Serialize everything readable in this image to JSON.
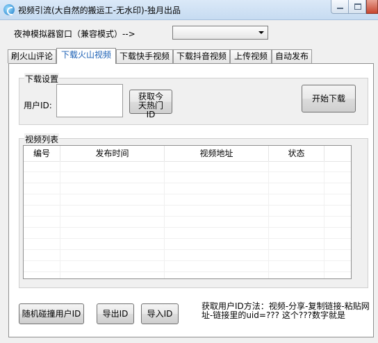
{
  "window": {
    "title": "视频引流(大自然的搬运工-无水印)-独月出品"
  },
  "emulator": {
    "label": "夜神模拟器窗口（兼容模式）-->",
    "selected_value": ""
  },
  "tabs": [
    {
      "label": "刷火山评论",
      "active": false
    },
    {
      "label": "下载火山视频",
      "active": true
    },
    {
      "label": "下载快手视频",
      "active": false
    },
    {
      "label": "下载抖音视频",
      "active": false
    },
    {
      "label": "上传视频",
      "active": false
    },
    {
      "label": "自动发布",
      "active": false
    }
  ],
  "download_settings": {
    "group_title": "下载设置",
    "user_id_label": "用户ID:",
    "user_id_value": "",
    "get_hot_id_button": "获取今天热门ID",
    "start_download_button": "开始下载"
  },
  "video_list": {
    "group_title": "视频列表",
    "columns": [
      "编号",
      "发布时间",
      "视频地址",
      "状态"
    ],
    "rows": []
  },
  "bottom": {
    "random_user_button": "随机碰撞用户ID",
    "export_button": "导出ID",
    "import_button": "导入ID",
    "help_text": "获取用户ID方法：视频-分享-复制链接-粘贴网址-链接里的uid=???  这个???数字就是"
  },
  "colors": {
    "active_tab_text": "#1a5fb4",
    "titlebar": "#c6dbf1",
    "close_button": "#c7462f"
  }
}
